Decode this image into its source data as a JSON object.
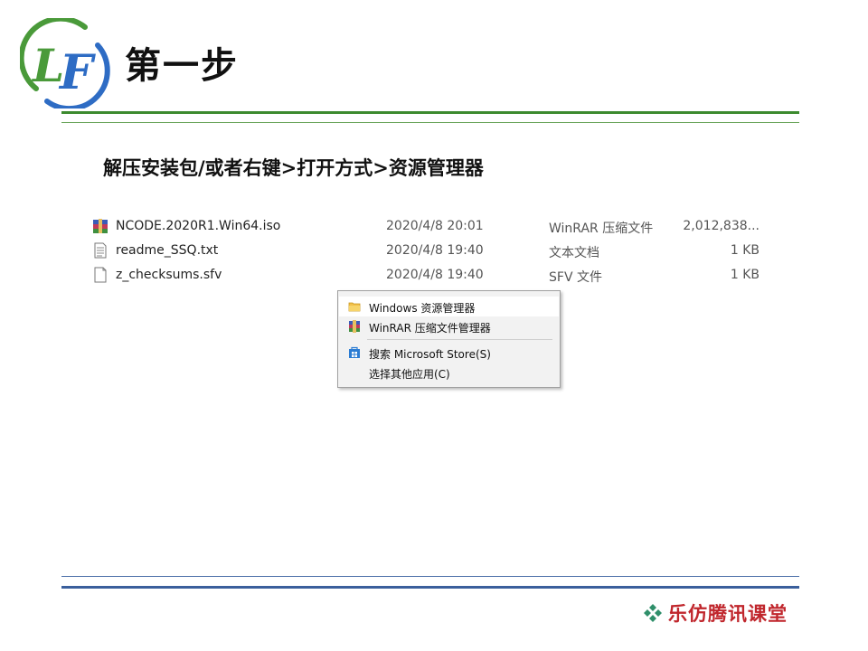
{
  "header": {
    "logo_text": "LF",
    "title": "第一步"
  },
  "subtitle": "解压安装包/或者右键>打开方式>资源管理器",
  "files": [
    {
      "name": "NCODE.2020R1.Win64.iso",
      "date": "2020/4/8 20:01",
      "type": "WinRAR 压缩文件",
      "size": "2,012,838...",
      "icon": "winrar-archive-icon"
    },
    {
      "name": "readme_SSQ.txt",
      "date": "2020/4/8 19:40",
      "type": "文本文档",
      "size": "1 KB",
      "icon": "text-file-icon"
    },
    {
      "name": "z_checksums.sfv",
      "date": "2020/4/8 19:40",
      "type": "SFV 文件",
      "size": "1 KB",
      "icon": "blank-file-icon"
    }
  ],
  "context_menu": {
    "items": [
      {
        "label": "Windows 资源管理器",
        "icon": "folder-icon"
      },
      {
        "label": "WinRAR 压缩文件管理器",
        "icon": "winrar-icon"
      },
      {
        "label": "搜索 Microsoft Store(S)",
        "icon": "store-icon"
      },
      {
        "label": "选择其他应用(C)",
        "icon": ""
      }
    ]
  },
  "footer": {
    "brand": "乐仿腾讯课堂"
  },
  "colors": {
    "title_rule": "#3c8a2e",
    "footer_rule": "#3a5f9c",
    "brand": "#c0262c",
    "menu_bg": "#f2f2f2"
  }
}
